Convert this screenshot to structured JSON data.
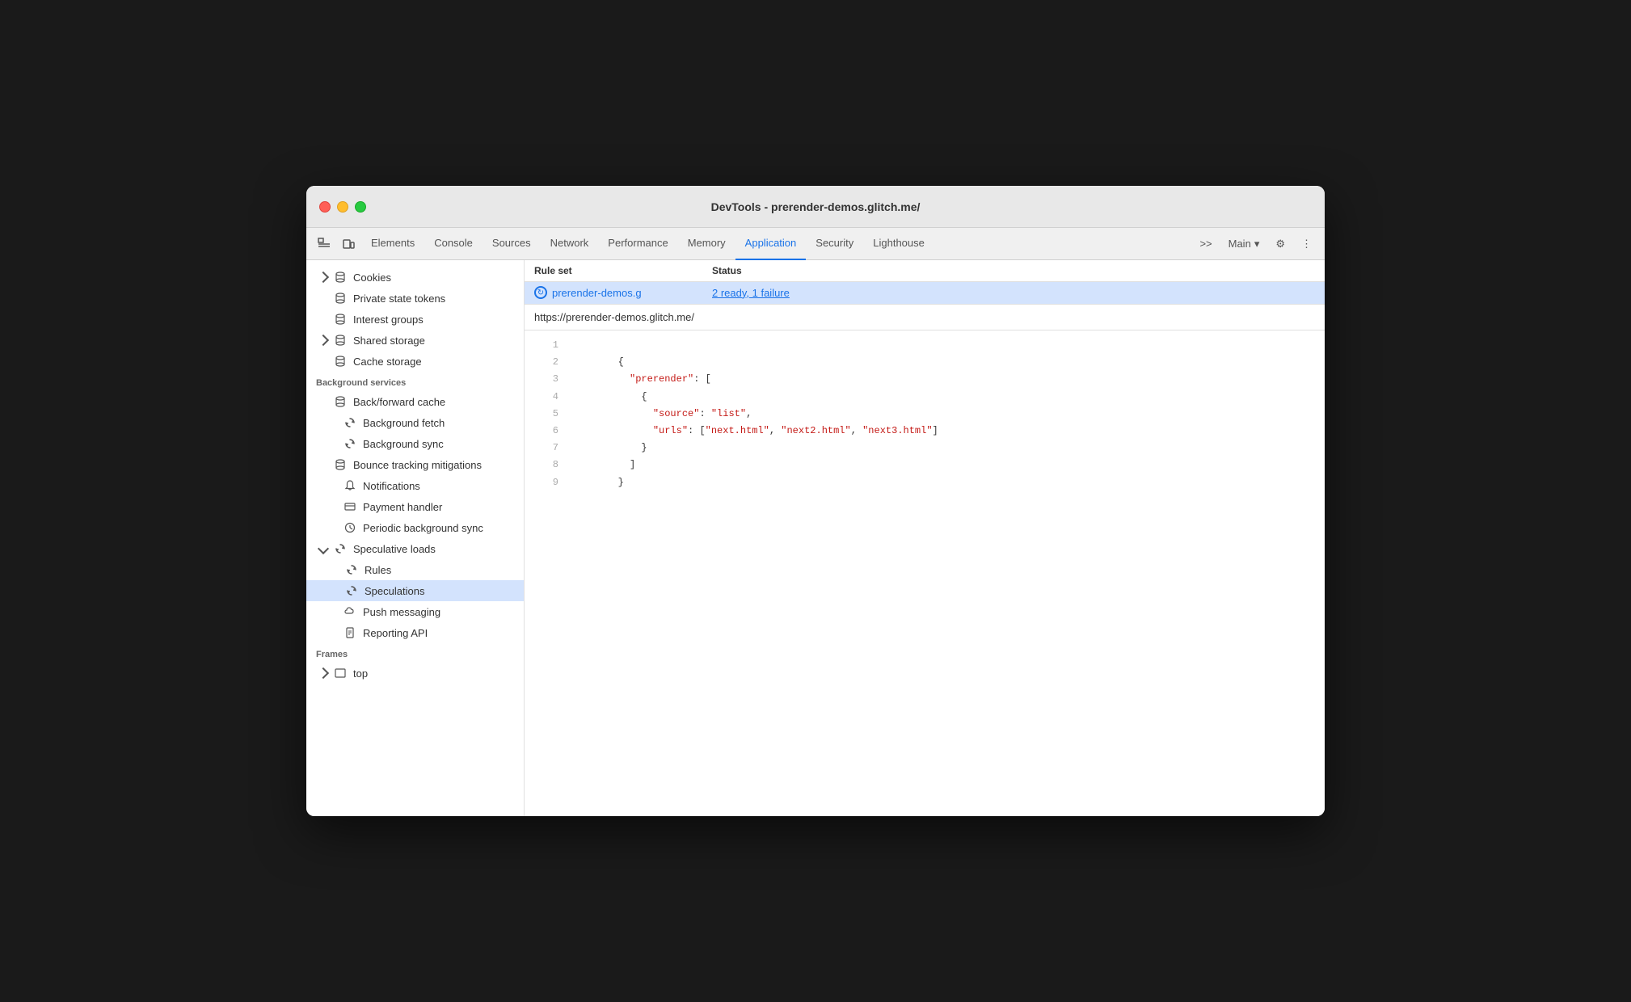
{
  "window": {
    "title": "DevTools - prerender-demos.glitch.me/"
  },
  "tabs": {
    "items": [
      {
        "label": "Elements",
        "active": false
      },
      {
        "label": "Console",
        "active": false
      },
      {
        "label": "Sources",
        "active": false
      },
      {
        "label": "Network",
        "active": false
      },
      {
        "label": "Performance",
        "active": false
      },
      {
        "label": "Memory",
        "active": false
      },
      {
        "label": "Application",
        "active": true
      },
      {
        "label": "Security",
        "active": false
      },
      {
        "label": "Lighthouse",
        "active": false
      }
    ],
    "overflow_label": ">>",
    "main_label": "Main",
    "settings_label": "⚙",
    "more_label": "⋮"
  },
  "sidebar": {
    "sections": [
      {
        "items": [
          {
            "label": "Cookies",
            "icon": "chevron-right",
            "depth": 0,
            "has_chevron": true
          },
          {
            "label": "Private state tokens",
            "icon": "cylinder",
            "depth": 0
          },
          {
            "label": "Interest groups",
            "icon": "cylinder",
            "depth": 0
          },
          {
            "label": "Shared storage",
            "icon": "chevron-right",
            "depth": 0,
            "has_chevron": true
          },
          {
            "label": "Cache storage",
            "icon": "cylinder",
            "depth": 0
          }
        ]
      },
      {
        "header": "Background services",
        "items": [
          {
            "label": "Back/forward cache",
            "icon": "cylinder",
            "depth": 0
          },
          {
            "label": "Background fetch",
            "icon": "sync",
            "depth": 1
          },
          {
            "label": "Background sync",
            "icon": "sync",
            "depth": 1
          },
          {
            "label": "Bounce tracking mitigations",
            "icon": "cylinder",
            "depth": 0
          },
          {
            "label": "Notifications",
            "icon": "bell",
            "depth": 1
          },
          {
            "label": "Payment handler",
            "icon": "card",
            "depth": 1
          },
          {
            "label": "Periodic background sync",
            "icon": "clock",
            "depth": 1
          },
          {
            "label": "Speculative loads",
            "icon": "sync",
            "depth": 0,
            "has_chevron_down": true
          },
          {
            "label": "Rules",
            "icon": "sync",
            "depth": 2,
            "active": false
          },
          {
            "label": "Speculations",
            "icon": "sync",
            "depth": 2,
            "active": false
          },
          {
            "label": "Push messaging",
            "icon": "cloud",
            "depth": 1
          },
          {
            "label": "Reporting API",
            "icon": "doc",
            "depth": 1
          }
        ]
      },
      {
        "header": "Frames",
        "items": [
          {
            "label": "top",
            "icon": "chevron-right",
            "depth": 0,
            "has_chevron": true
          }
        ]
      }
    ]
  },
  "table": {
    "headers": [
      {
        "label": "Rule set"
      },
      {
        "label": "Status"
      }
    ],
    "rows": [
      {
        "ruleset": "prerender-demos.g",
        "status": "2 ready, 1 failure",
        "selected": true
      }
    ]
  },
  "detail": {
    "url": "https://prerender-demos.glitch.me/",
    "code_lines": [
      {
        "num": "1",
        "content": ""
      },
      {
        "num": "2",
        "content": "        {"
      },
      {
        "num": "3",
        "content": "          \"prerender\": ["
      },
      {
        "num": "4",
        "content": "            {"
      },
      {
        "num": "5",
        "content": "              \"source\": \"list\","
      },
      {
        "num": "6",
        "content": "              \"urls\": [\"next.html\", \"next2.html\", \"next3.html\"]"
      },
      {
        "num": "7",
        "content": "            }"
      },
      {
        "num": "8",
        "content": "          ]"
      },
      {
        "num": "9",
        "content": "        }"
      }
    ]
  }
}
